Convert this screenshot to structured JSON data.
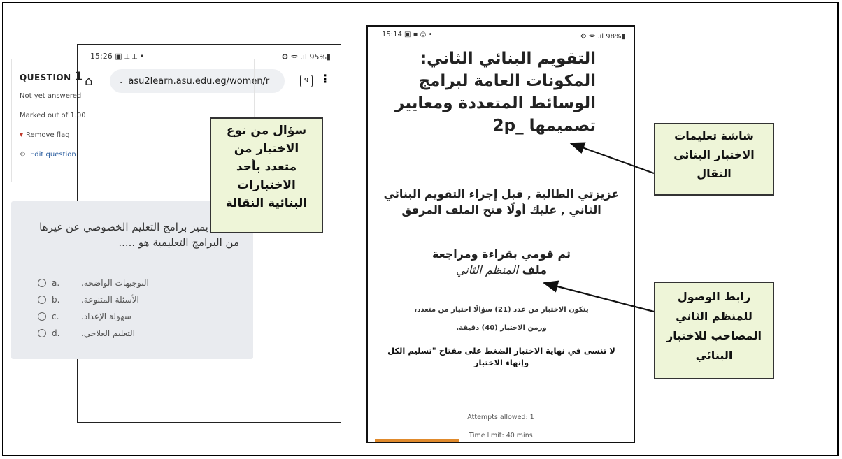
{
  "phone1": {
    "status_time": "15:26",
    "status_icons_left": "▣ ⟂ ⟂ •",
    "status_right": "⚙ ᯤ .ıl 95%▮",
    "url": "asu2learn.asu.edu.eg/women/r",
    "tabs_count": "9",
    "question_label": "QUESTION",
    "question_number": "1",
    "status": "Not yet answered",
    "marks": "Marked out of 1.00",
    "flag_label": "Remove flag",
    "edit_label": "Edit question",
    "question_text": "أهم ما يميز برامج التعليم الخصوصي عن غيرها من البرامج التعليمية هو .....",
    "options": [
      {
        "letter": "a.",
        "text": ".التوجيهات الواضحة"
      },
      {
        "letter": "b.",
        "text": ".الأسئلة المتنوعة"
      },
      {
        "letter": "c.",
        "text": ".سهولة الإعداد"
      },
      {
        "letter": "d.",
        "text": ".التعليم العلاجي"
      }
    ]
  },
  "callout_left": {
    "lines": [
      "سؤال من نوع",
      "الاختيار من",
      "متعدد بأحد",
      "الاختبارات",
      "البنائية النقالة"
    ]
  },
  "phone2": {
    "status_time": "15:14",
    "status_icons_left": "▣ ▪ ◎ •",
    "status_right": "⚙ ᯤ .ıl 98%▮",
    "title_lines": [
      "التقويم البنائي الثاني:",
      "المكونات العامة لبرامج",
      "الوسائط المتعددة ومعايير",
      "تصميمها _2p"
    ],
    "intro": "عزيزتي الطالبة , قبل إجراء التقويم البنائي الثاني , عليك أولًا فتح الملف المرفق",
    "instruction_line": "ثم قومي بقراءة ومراجعة",
    "file_prefix": "ملف",
    "file_link": "المنظم الثاني",
    "info_line1": "يتكون الاختبار من عدد (21) سؤالًا اختيار من متعدد،",
    "info_line2": "وزمن الاختبار (40) دقيقة.",
    "note": "لا تنسى في نهاية الاختبار الضغط على مفتاح \"تسليم الكل وإنهاء الاختبار",
    "attempts": "Attempts allowed: 1",
    "time_limit": "Time limit: 40 mins"
  },
  "callout_instructions": {
    "lines": [
      "شاشة تعليمات",
      "الاختبار البنائي",
      "النقال"
    ]
  },
  "callout_link": {
    "lines": [
      "رابط الوصول",
      "للمنظم الثاني",
      "المصاحب للاختبار",
      "البنائي"
    ]
  }
}
